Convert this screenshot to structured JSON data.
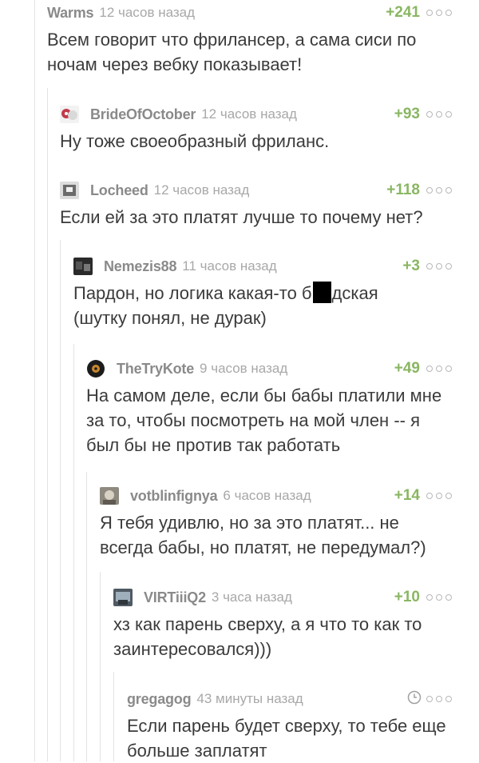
{
  "comments": [
    {
      "author": "Warms",
      "time": "12 часов назад",
      "rating": "+241",
      "text": "Всем говорит что фрилансер, а сама сиси по ночам через вебку показывает!"
    },
    {
      "author": "BrideOfOctober",
      "time": "12 часов назад",
      "rating": "+93",
      "text": "Ну тоже своеобразный фриланс."
    },
    {
      "author": "Locheed",
      "time": "12 часов назад",
      "rating": "+118",
      "text": "Если ей за это платят лучше то почему нет?"
    },
    {
      "author": "Nemezis88",
      "time": "11 часов назад",
      "rating": "+3",
      "text_before": "Пардон, но логика какая-то б",
      "text_after": "дская",
      "text_line2": "(шутку понял, не дурак)"
    },
    {
      "author": "TheTryKote",
      "time": "9 часов назад",
      "rating": "+49",
      "text": "На самом деле, если бы бабы платили мне за то, чтобы посмотреть на мой член -- я был бы не против так работать"
    },
    {
      "author": "votblinfignya",
      "time": "6 часов назад",
      "rating": "+14",
      "text": "Я тебя удивлю, но за это платят... не всегда бабы, но платят, не передумал?)"
    },
    {
      "author": "VIRTiiiQ2",
      "time": "3 часа назад",
      "rating": "+10",
      "text": "хз как парень сверху, а я что то как то заинтересовался)))"
    },
    {
      "author": "gregagog",
      "time": "43 минуты назад",
      "rating_icon": "clock-icon",
      "text": "Если парень будет сверху, то тебе еще больше заплатят"
    }
  ],
  "icons": {
    "more": "more-dots-icon",
    "clock": "clock-icon"
  },
  "colors": {
    "rating": "#8ab663",
    "author": "#8a8a8a",
    "time": "#a8a8a8",
    "text": "#3b3b3b",
    "thread_line": "#e3e3e3"
  }
}
